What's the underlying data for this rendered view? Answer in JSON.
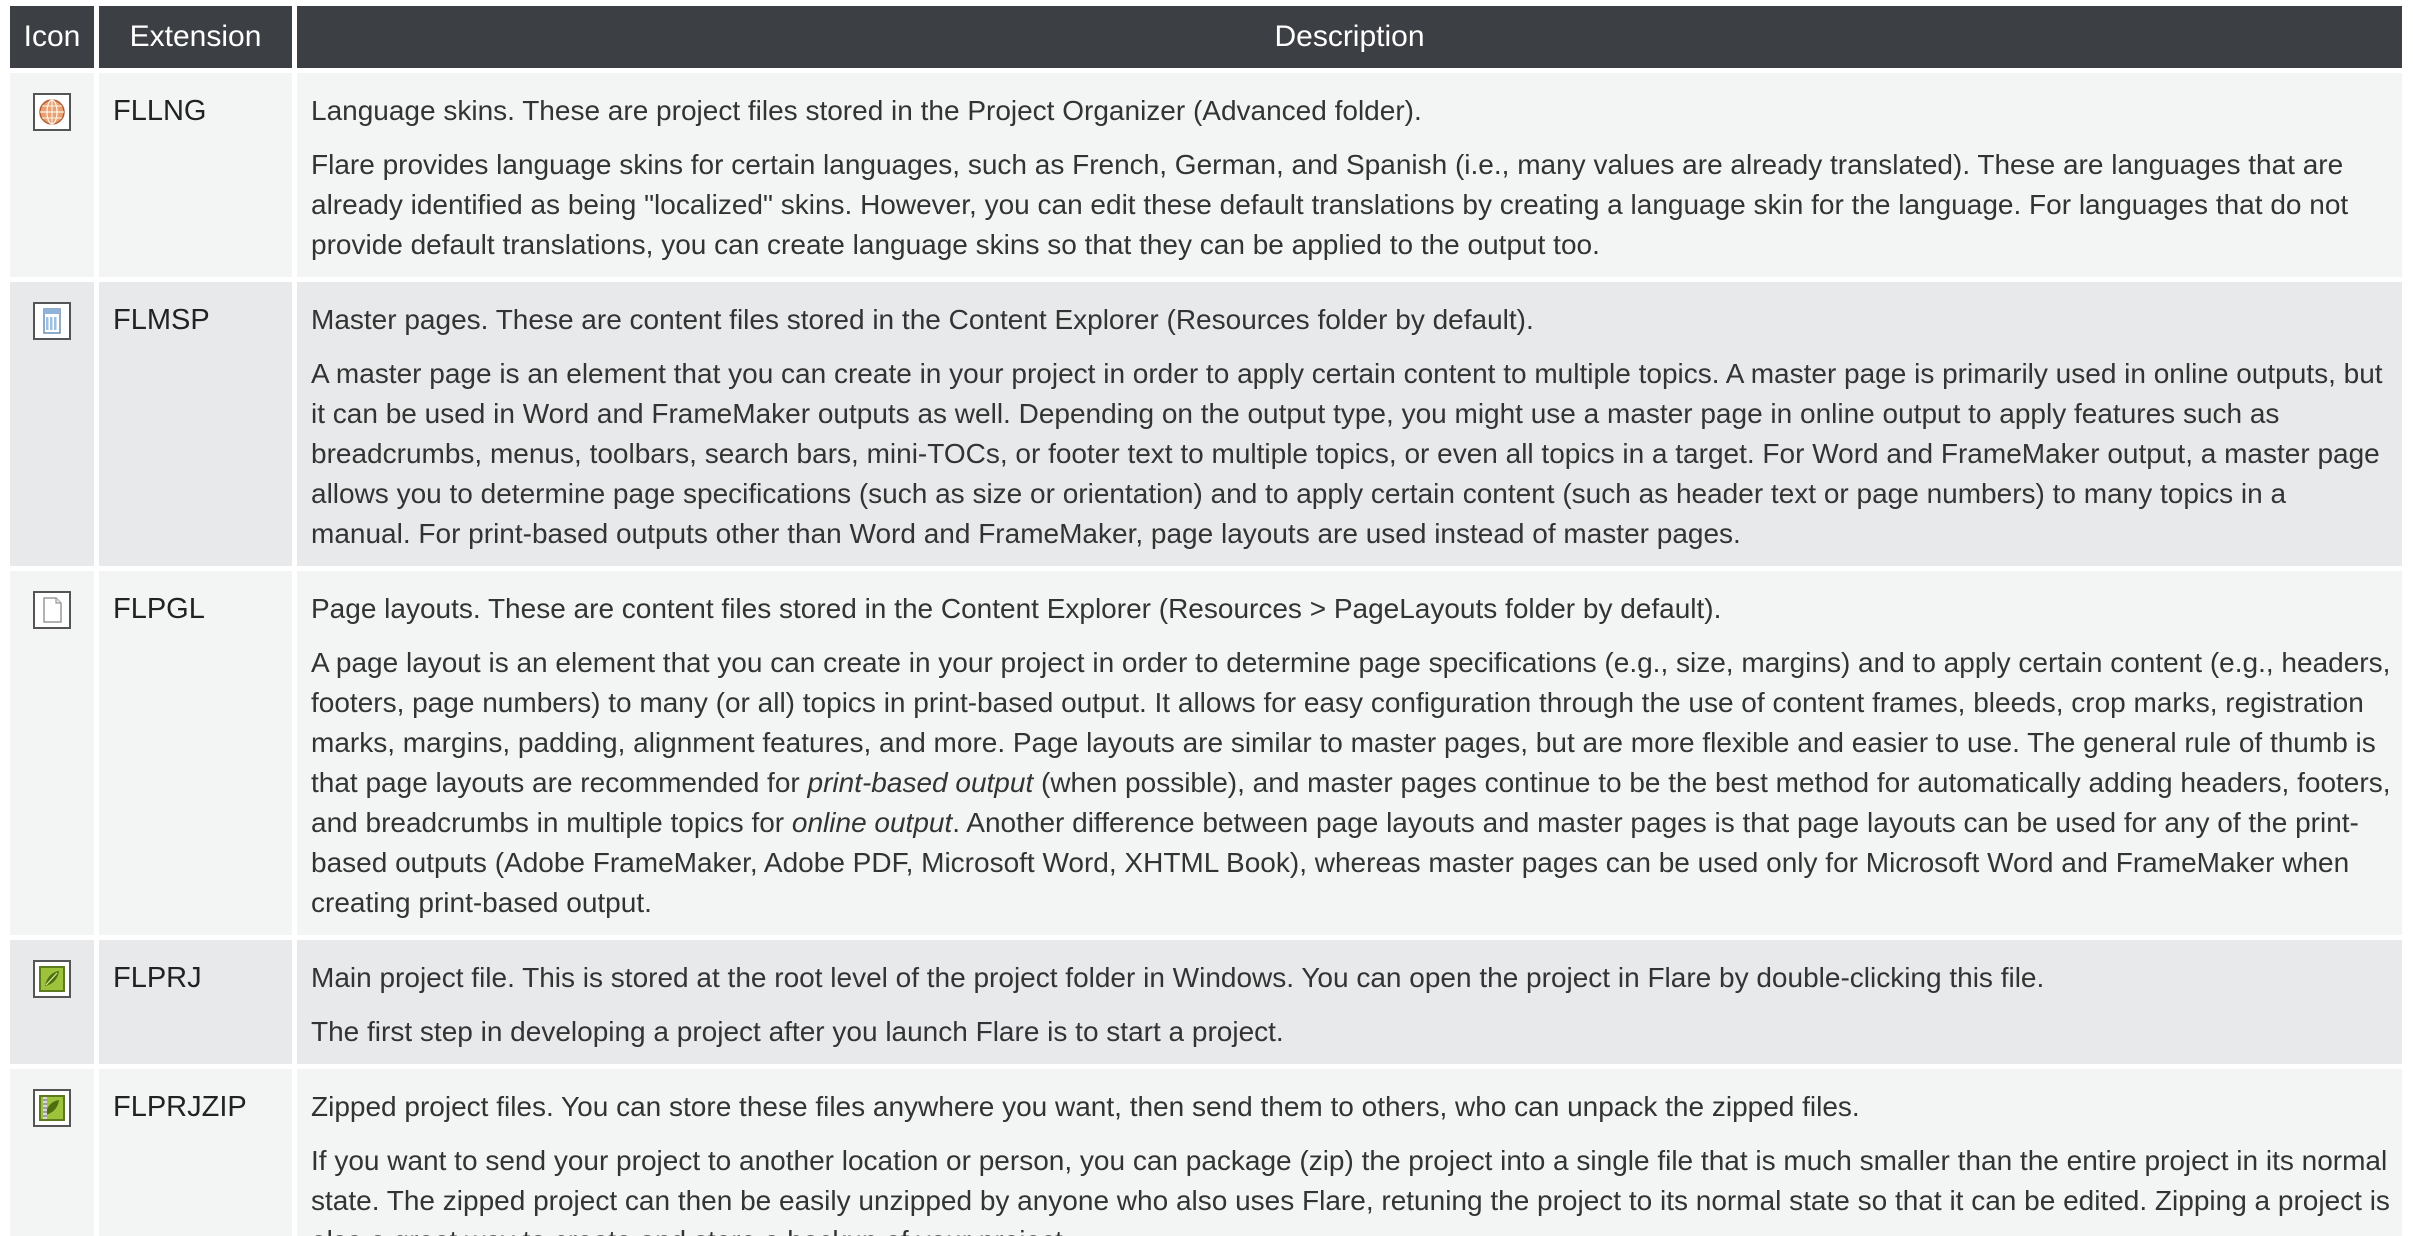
{
  "header": {
    "icon": "Icon",
    "extension": "Extension",
    "description": "Description"
  },
  "rows": [
    {
      "icon": "globe-skin-icon",
      "extension": "FLLNG",
      "summary": "Language skins. These are project files stored in the Project Organizer (Advanced folder).",
      "detail": "Flare provides language skins for certain languages, such as French, German, and Spanish (i.e., many values are already translated). These are languages that are already identified as being \"localized\" skins. However, you can edit these default translations by creating a language skin for the language. For languages that do not provide default translations, you can create language skins so that they can be applied to the output too."
    },
    {
      "icon": "master-page-icon",
      "extension": "FLMSP",
      "summary": "Master pages. These are content files stored in the Content Explorer (Resources folder by default).",
      "detail": "A master page is an element that you can create in your project in order to apply certain content to multiple topics. A master page is primarily used in online outputs, but it can be used in Word and FrameMaker outputs as well. Depending on the output type, you might use a master page in online output to apply features such as breadcrumbs, menus, toolbars, search bars, mini-TOCs, or footer text to multiple topics, or even all topics in a target. For Word and FrameMaker output, a master page allows you to determine page specifications (such as size or orientation) and to apply certain content (such as header text or page numbers) to many topics in a manual. For print-based outputs other than Word and FrameMaker, page layouts are used instead of master pages."
    },
    {
      "icon": "page-layout-icon",
      "extension": "FLPGL",
      "summary": "Page layouts. These are content files stored in the Content Explorer (Resources > PageLayouts folder by default).",
      "detail_a": "A page layout is an element that you can create in your project in order to determine page specifications (e.g., size, margins) and to apply certain content (e.g., headers, footers, page numbers) to many (or all) topics in print-based output. It allows for easy configuration through the use of content frames, bleeds, crop marks, registration marks, margins, padding, alignment features, and more. Page layouts are similar to master pages, but are more flexible and easier to use. The general rule of thumb is that page layouts are recommended for ",
      "detail_em1": "print-based output",
      "detail_b": " (when possible), and master pages continue to be the best method for automatically adding headers, footers, and breadcrumbs in multiple topics for ",
      "detail_em2": "online output",
      "detail_c": ". Another difference between page layouts and master pages is that page layouts can be used for any of the print-based outputs (Adobe FrameMaker, Adobe PDF, Microsoft Word, XHTML Book), whereas master pages can be used only for Microsoft Word and FrameMaker when creating print-based output."
    },
    {
      "icon": "project-file-icon",
      "extension": "FLPRJ",
      "summary": "Main project file. This is stored at the root level of the project folder in Windows. You can open the project in Flare by double-clicking this file.",
      "detail": "The first step in developing a project after you launch Flare is to start a project."
    },
    {
      "icon": "zipped-project-icon",
      "extension": "FLPRJZIP",
      "summary": "Zipped project files. You can store these files anywhere you want, then send them to others, who can unpack the zipped files.",
      "detail": "If you want to send your project to another location or person, you can package (zip) the project into a single file that is much smaller than the entire project in its normal state. The zipped project can then be easily unzipped by anyone who also uses Flare, retuning the project to its normal state so that it can be edited. Zipping a project is also a great way to create and store a backup of your project."
    }
  ]
}
